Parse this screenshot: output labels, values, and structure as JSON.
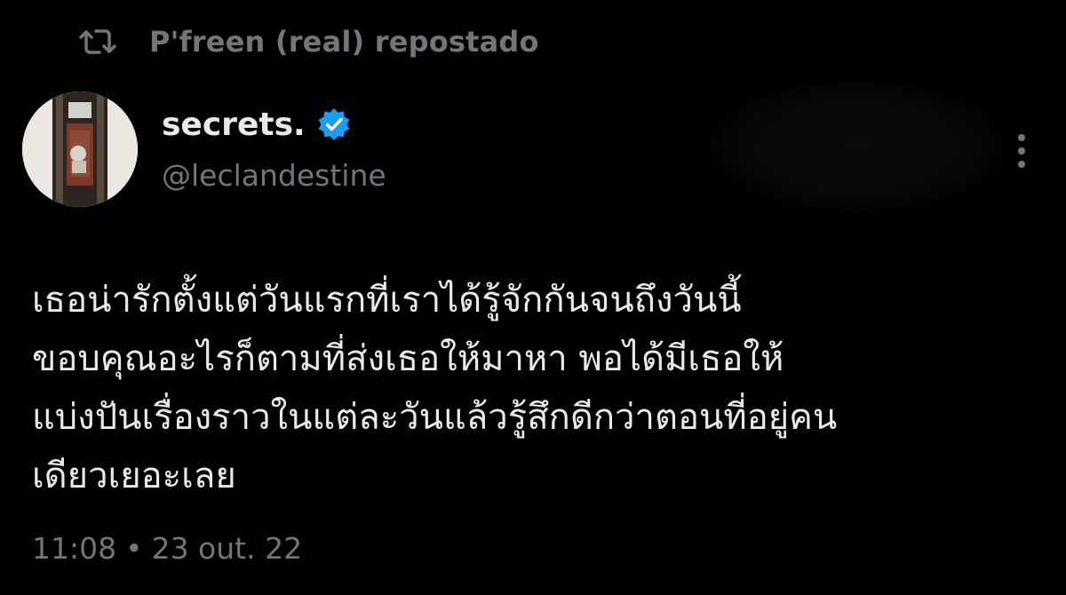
{
  "repost": {
    "icon": "repost-icon",
    "text": "P'freen (real) repostado"
  },
  "author": {
    "display_name": "secrets.",
    "handle": "@leclandestine",
    "verified_icon": "verified-badge-icon",
    "verified_color": "#1d9bf0"
  },
  "tweet": {
    "lines": [
      "เธอน่ารักตั้งแต่วันแรกที่เราได้รู้จักกันจนถึงวันนี้",
      "ขอบคุณอะไรก็ตามที่ส่งเธอให้มาหา พอได้มีเธอให้",
      "แบ่งปันเรื่องราวในแต่ละวันแล้วรู้สึกดีกว่าตอนที่อยู่คน",
      "เดียวเยอะเลย"
    ]
  },
  "meta": {
    "time": "11:08",
    "separator": "•",
    "date": "23 out. 22"
  },
  "more_icon": "more-vertical-icon",
  "colors": {
    "background": "#000000",
    "primary_text": "#e7e9ea",
    "secondary_text": "#71767b",
    "accent": "#1d9bf0"
  }
}
